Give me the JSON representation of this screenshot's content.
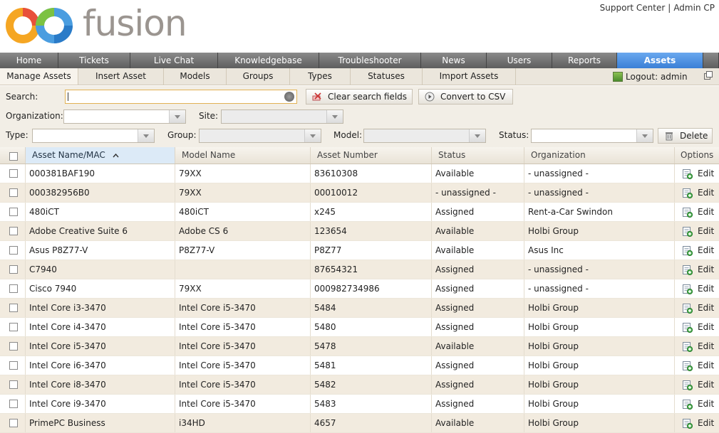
{
  "brand": {
    "name": "fusion"
  },
  "toplinks": [
    "Support Center",
    "Admin CP"
  ],
  "nav": {
    "tabs": [
      {
        "label": "Home",
        "width": 82
      },
      {
        "label": "Tickets",
        "width": 101
      },
      {
        "label": "Live Chat",
        "width": 123
      },
      {
        "label": "Knowledgebase",
        "width": 142
      },
      {
        "label": "Troubleshooter",
        "width": 143
      },
      {
        "label": "News",
        "width": 92
      },
      {
        "label": "Users",
        "width": 92
      },
      {
        "label": "Reports",
        "width": 91
      },
      {
        "label": "Assets",
        "width": 121,
        "active": true
      },
      {
        "label": "",
        "width": 22
      }
    ]
  },
  "subnav": {
    "items": [
      {
        "label": "Manage Assets",
        "width": 110,
        "active": true
      },
      {
        "label": "Insert Asset",
        "width": 120
      },
      {
        "label": "Models",
        "width": 88
      },
      {
        "label": "Groups",
        "width": 89
      },
      {
        "label": "Types",
        "width": 85
      },
      {
        "label": "Statuses",
        "width": 101
      },
      {
        "label": "Import Assets",
        "width": 131
      }
    ],
    "logout": "Logout: admin"
  },
  "filters": {
    "search_label": "Search:",
    "search_value": "",
    "clear_label": "Clear search fields",
    "csv_label": "Convert to CSV",
    "organization_label": "Organization:",
    "site_label": "Site:",
    "type_label": "Type:",
    "group_label": "Group:",
    "model_label": "Model:",
    "status_label": "Status:",
    "delete_label": "Delete"
  },
  "table": {
    "columns": [
      "Asset Name/MAC",
      "Model Name",
      "Asset Number",
      "Status",
      "Organization",
      "Options"
    ],
    "edit_label": "Edit",
    "rows": [
      [
        "000381BAF190",
        "79XX",
        "83610308",
        "Available",
        "- unassigned -"
      ],
      [
        "000382956B0",
        "79XX",
        "00010012",
        "- unassigned -",
        "- unassigned -"
      ],
      [
        "480iCT",
        "480iCT",
        "x245",
        "Assigned",
        "Rent-a-Car Swindon"
      ],
      [
        "Adobe Creative Suite 6",
        "Adobe CS 6",
        "123654",
        "Available",
        "Holbi Group"
      ],
      [
        "Asus P8Z77-V",
        "P8Z77-V",
        "P8Z77",
        "Available",
        "Asus Inc"
      ],
      [
        "C7940",
        "",
        "87654321",
        "Assigned",
        "- unassigned -"
      ],
      [
        "Cisco 7940",
        "79XX",
        "000982734986",
        "Assigned",
        "- unassigned -"
      ],
      [
        "Intel Core i3-3470",
        "Intel Core i5-3470",
        "5484",
        "Assigned",
        "Holbi Group"
      ],
      [
        "Intel Core i4-3470",
        "Intel Core i5-3470",
        "5480",
        "Assigned",
        "Holbi Group"
      ],
      [
        "Intel Core i5-3470",
        "Intel Core i5-3470",
        "5478",
        "Available",
        "Holbi Group"
      ],
      [
        "Intel Core i6-3470",
        "Intel Core i5-3470",
        "5481",
        "Assigned",
        "Holbi Group"
      ],
      [
        "Intel Core i8-3470",
        "Intel Core i5-3470",
        "5482",
        "Assigned",
        "Holbi Group"
      ],
      [
        "Intel Core i9-3470",
        "Intel Core i5-3470",
        "5483",
        "Assigned",
        "Holbi Group"
      ],
      [
        "PrimePC Business",
        "i34HD",
        "4657",
        "Available",
        "Holbi Group"
      ]
    ]
  },
  "colors": {
    "accent": "#3a7fd6",
    "nav": "#6e6e6e",
    "row_alt": "#f2ebdf"
  }
}
